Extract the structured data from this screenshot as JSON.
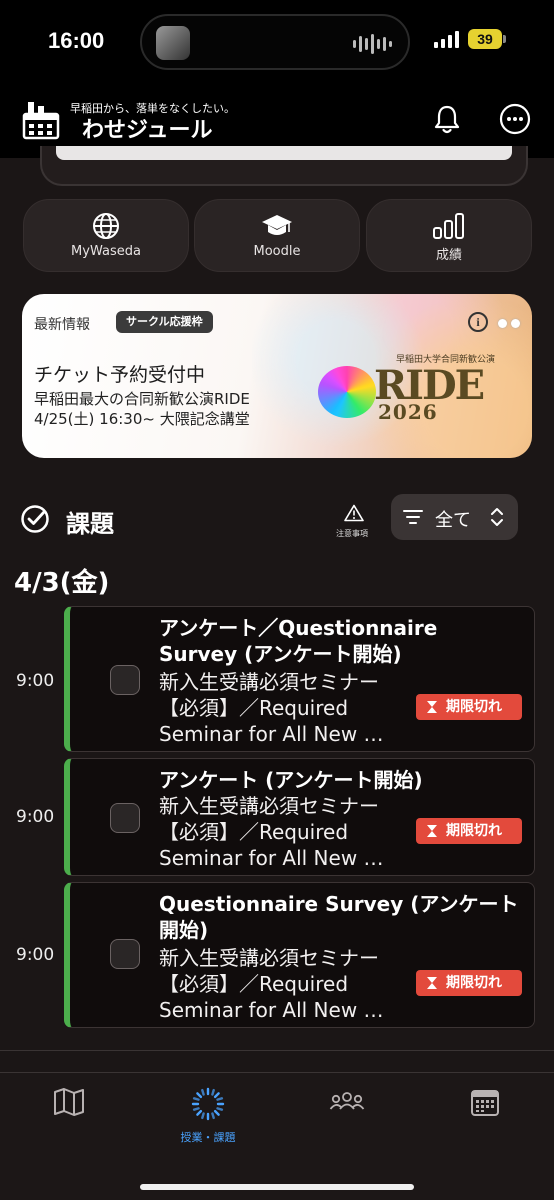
{
  "status_bar": {
    "time": "16:00",
    "battery": "39"
  },
  "header": {
    "tagline": "早稲田から、落単をなくしたい。",
    "app_name": "わせジュール",
    "icons": [
      "bell-icon",
      "more-icon"
    ]
  },
  "quick_links": [
    {
      "label": "MyWaseda",
      "icon": "globe-icon"
    },
    {
      "label": "Moodle",
      "icon": "graduation-cap-icon"
    },
    {
      "label": "成績",
      "icon": "bar-chart-icon"
    }
  ],
  "banner": {
    "tag": "最新情報",
    "badge": "サークル応援枠",
    "headline": "チケット予約受付中",
    "line2": "早稲田最大の合同新歓公演RIDE",
    "line3": "4/25(土) 16:30~ 大隈記念講堂",
    "logo_text": "RIDE",
    "logo_year": "2026",
    "logo_caption": "早稲田大学合同新歓公演"
  },
  "tasks": {
    "title": "課題",
    "notes_label": "注意事項",
    "filter_label": "全て",
    "date": "4/3(金)",
    "expired_label": "期限切れ",
    "items": [
      {
        "time": "9:00",
        "title": "アンケート／Questionnaire Survey (アンケート開始)",
        "course": "新入生受講必須セミナー【必須】／Required Seminar for All New …"
      },
      {
        "time": "9:00",
        "title": "アンケート (アンケート開始)",
        "course": "新入生受講必須セミナー【必須】／Required Seminar for All New …"
      },
      {
        "time": "9:00",
        "title": "Questionnaire Survey (アンケート開始)",
        "course": "新入生受講必須セミナー【必須】／Required Seminar for All New …"
      }
    ]
  },
  "tabbar": {
    "tabs": [
      {
        "icon": "map-icon",
        "label": ""
      },
      {
        "icon": "loading-spinner-icon",
        "label": "授業・課題",
        "active": true
      },
      {
        "icon": "community-icon",
        "label": ""
      },
      {
        "icon": "calendar-icon",
        "label": ""
      }
    ]
  },
  "colors": {
    "accent_green": "#4cae4c",
    "expired_red": "#e34a3c",
    "active_blue": "#4aa3ff"
  }
}
